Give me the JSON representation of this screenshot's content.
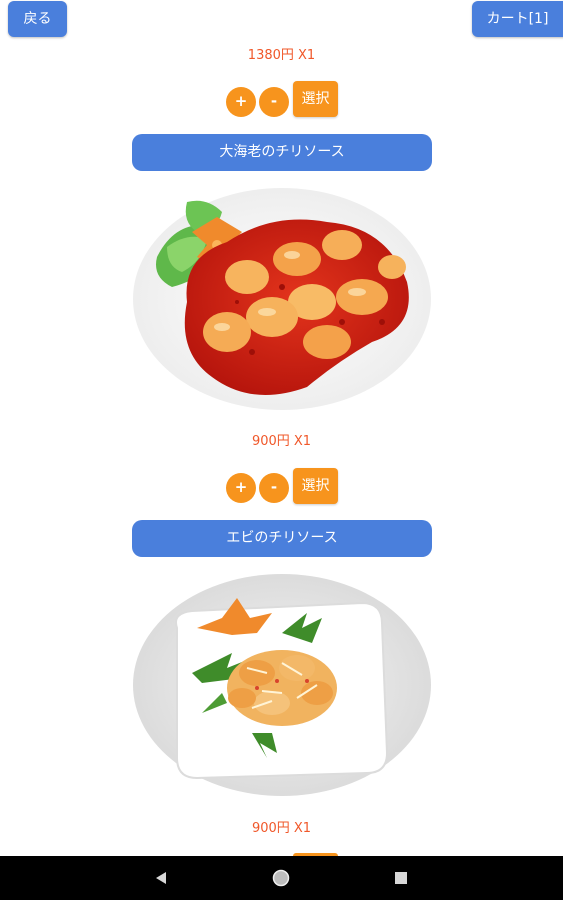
{
  "header": {
    "back_label": "戻る",
    "cart_label": "カート[1]"
  },
  "items": [
    {
      "price_label": "1380円 X1",
      "plus_label": "+",
      "minus_label": "-",
      "select_label": "選択"
    },
    {
      "name": "大海老のチリソース",
      "image_icon": "dish-photo-large-shrimp-chili",
      "price_label": "900円 X1",
      "plus_label": "+",
      "minus_label": "-",
      "select_label": "選択"
    },
    {
      "name": "エビのチリソース",
      "image_icon": "dish-photo-shrimp-chili",
      "price_label": "900円 X1"
    }
  ],
  "nav": {
    "back_icon": "triangle-back-icon",
    "home_icon": "circle-home-icon",
    "recents_icon": "square-recents-icon"
  },
  "colors": {
    "blue_button": "#4a7fdc",
    "orange_button": "#f7941d",
    "price_text": "#f0582a"
  }
}
